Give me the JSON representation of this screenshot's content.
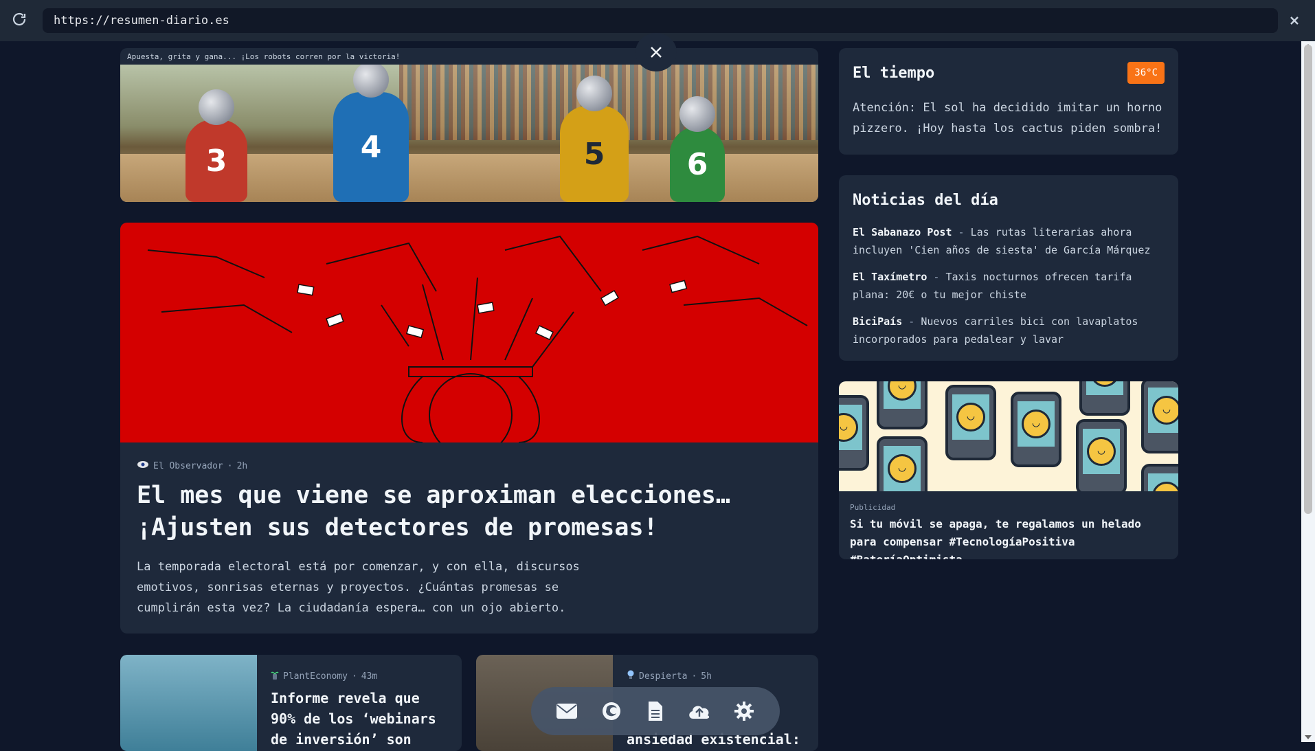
{
  "browser": {
    "url": "https://resumen-diario.es"
  },
  "banner": {
    "caption": "Apuesta, grita y gana... ¡Los robots corren por la victoria!",
    "robots": [
      "3",
      "4",
      "5",
      "6"
    ]
  },
  "article": {
    "source": "El Observador",
    "age": "2h",
    "title": "El mes que viene se aproximan elecciones… ¡Ajusten sus detectores de promesas!",
    "body": "La temporada electoral está por comenzar, y con ella, discursos emotivos, sonrisas eternas y proyectos. ¿Cuántas promesas se cumplirán esta vez? La ciudadanía espera… con un ojo abierto."
  },
  "small_cards": [
    {
      "source": "PlantEconomy",
      "age": "43m",
      "title": "Informe revela que 90% de los ‘webinars de inversión’ son"
    },
    {
      "source": "Despierta",
      "age": "5h",
      "title": "ansiedad existencial:"
    }
  ],
  "weather": {
    "heading": "El tiempo",
    "temperature": "36°C",
    "text": "Atención: El sol ha decidido imitar un horno pizzero. ¡Hoy hasta los cactus piden sombra!"
  },
  "news": {
    "heading": "Noticias del día",
    "items": [
      {
        "source": "El Sabanazo Post",
        "text": "Las rutas literarias ahora incluyen 'Cien años de siesta' de García Márquez"
      },
      {
        "source": "El Taxímetro",
        "text": "Taxis nocturnos ofrecen tarifa plana: 20€ o tu mejor chiste"
      },
      {
        "source": "BiciPaís",
        "text": "Nuevos carriles bici con lavaplatos incorporados para pedalear y lavar"
      }
    ]
  },
  "ad": {
    "label": "Publicidad",
    "text": "Si tu móvil se apaga, te regalamos un helado para compensar #TecnologíaPositiva #BateríaOptimista"
  },
  "dock": {
    "icons": [
      "mail-icon",
      "firefox-icon",
      "document-icon",
      "cloud-upload-icon",
      "gear-icon"
    ]
  },
  "colors": {
    "page_bg": "#0f172a",
    "card_bg": "#1e293b",
    "accent_orange": "#f97316",
    "article_red": "#d40000"
  }
}
